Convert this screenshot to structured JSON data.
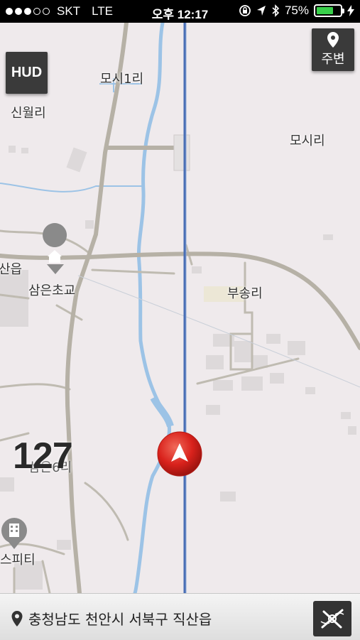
{
  "status": {
    "carrier": "SKT",
    "network": "LTE",
    "time": "오후 12:17",
    "battery": "75%",
    "battery_level": 0.75,
    "signal_bars": 3
  },
  "map": {
    "labels": [
      "모시1리",
      "신월리",
      "모시리",
      "산읍",
      "삼은초교",
      "부송리",
      "삼은6리",
      "스피티"
    ],
    "poi_icons": [
      "school-icon",
      "building-icon"
    ]
  },
  "hud_button": "HUD",
  "nearby_button": "주변",
  "speed": "127",
  "address": "충청남도 천안시 서북구 직산읍",
  "colors": {
    "route": "#4a6fb5",
    "river": "#9cc3e6",
    "marker": "#d9221c",
    "battery": "#39d04b"
  }
}
